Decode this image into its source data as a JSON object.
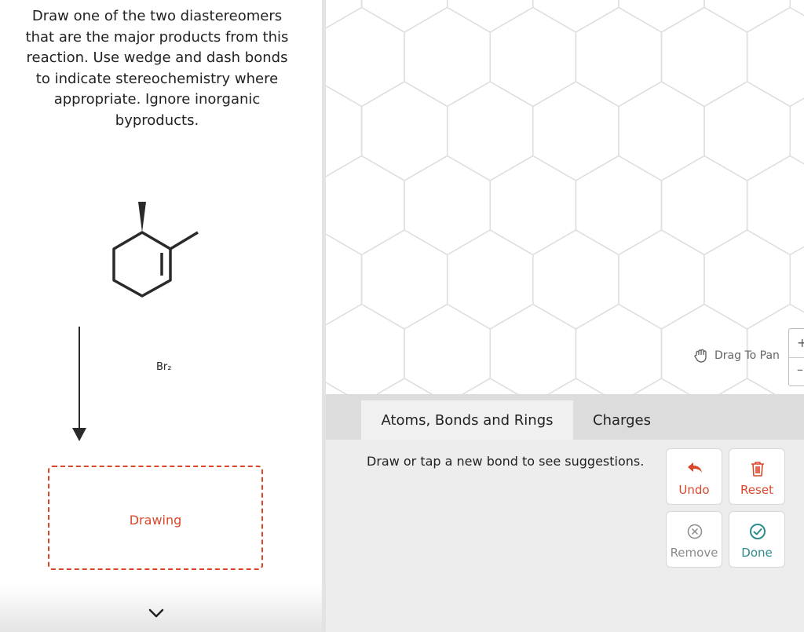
{
  "question": {
    "lines": [
      "Draw one of the two diastereomers",
      "that are the major products from this",
      "reaction. Use wedge and dash bonds",
      "to indicate stereochemistry where",
      "appropriate. Ignore inorganic",
      "byproducts."
    ]
  },
  "reaction": {
    "reagent": "Br₂"
  },
  "answer_box": {
    "label": "Drawing"
  },
  "canvas": {
    "drag_hint": "Drag To Pan",
    "zoom_in": "+",
    "zoom_out": "–"
  },
  "tabs": [
    {
      "label": "Atoms, Bonds and Rings",
      "active": true
    },
    {
      "label": "Charges",
      "active": false
    }
  ],
  "tools": {
    "hint": "Draw or tap a new bond to see suggestions.",
    "undo": "Undo",
    "reset": "Reset",
    "remove": "Remove",
    "done": "Done"
  },
  "colors": {
    "accent_red": "#d9472b",
    "done_teal": "#2e8b8b",
    "grid_line": "#dedede"
  },
  "icons": [
    "hand-icon",
    "undo-arrow-icon",
    "trash-icon",
    "remove-circle-x-icon",
    "done-check-icon",
    "chevron-down-icon"
  ]
}
